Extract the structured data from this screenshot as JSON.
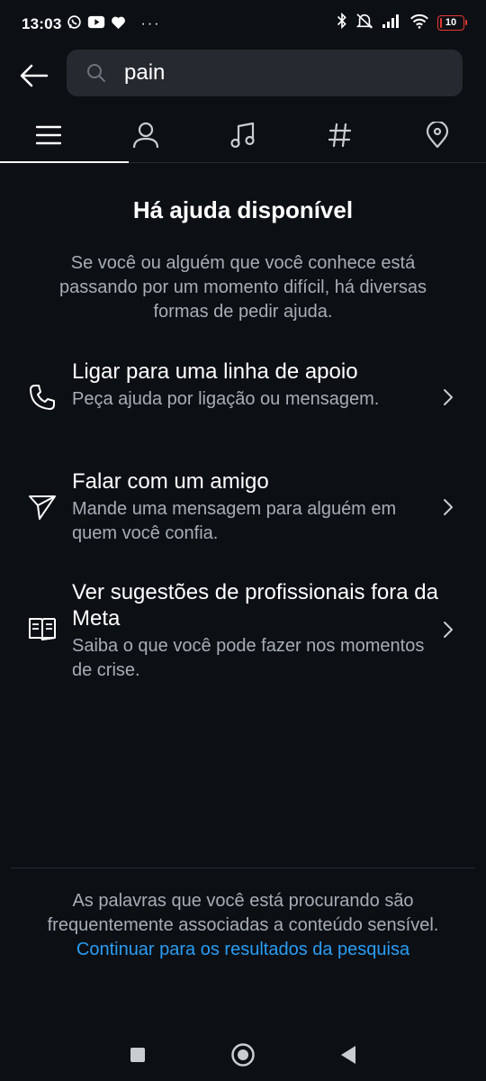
{
  "status_bar": {
    "time": "13:03",
    "battery_level": "10",
    "battery_fraction": 0.1,
    "more_indicator": "···",
    "left_icons": [
      "whatsapp-icon",
      "youtube-icon",
      "heart-icon"
    ],
    "right_icons": [
      "bluetooth-icon",
      "mute-icon",
      "signal-icon",
      "wifi-icon",
      "battery-icon"
    ]
  },
  "header": {
    "search_value": "pain"
  },
  "tabs": [
    {
      "name": "top",
      "icon": "menu-icon",
      "active": true
    },
    {
      "name": "accounts",
      "icon": "person-icon",
      "active": false
    },
    {
      "name": "audio",
      "icon": "music-note-icon",
      "active": false
    },
    {
      "name": "tags",
      "icon": "hashtag-icon",
      "active": false
    },
    {
      "name": "places",
      "icon": "location-pin-icon",
      "active": false
    }
  ],
  "help": {
    "title": "Há ajuda disponível",
    "subtitle": "Se você ou alguém que você conhece está passando por um momento difícil, há diversas formas de pedir ajuda.",
    "options": [
      {
        "icon": "phone-icon",
        "title": "Ligar para uma linha de apoio",
        "description": "Peça ajuda por ligação ou mensagem."
      },
      {
        "icon": "send-icon",
        "title": "Falar com um amigo",
        "description": "Mande uma mensagem para alguém em quem você confia."
      },
      {
        "icon": "book-icon",
        "title": "Ver sugestões de profissionais fora da Meta",
        "description": "Saiba o que você pode fazer nos momentos de crise."
      }
    ]
  },
  "footer": {
    "text": "As palavras que você está procurando são frequentemente associadas a conteúdo sensível.",
    "link": "Continuar para os resultados da pesquisa"
  },
  "colors": {
    "background": "#0c0f14",
    "search_field": "#262a30",
    "link": "#2a9df4",
    "secondary_text": "#a8adb5",
    "battery_low": "#e53935"
  }
}
